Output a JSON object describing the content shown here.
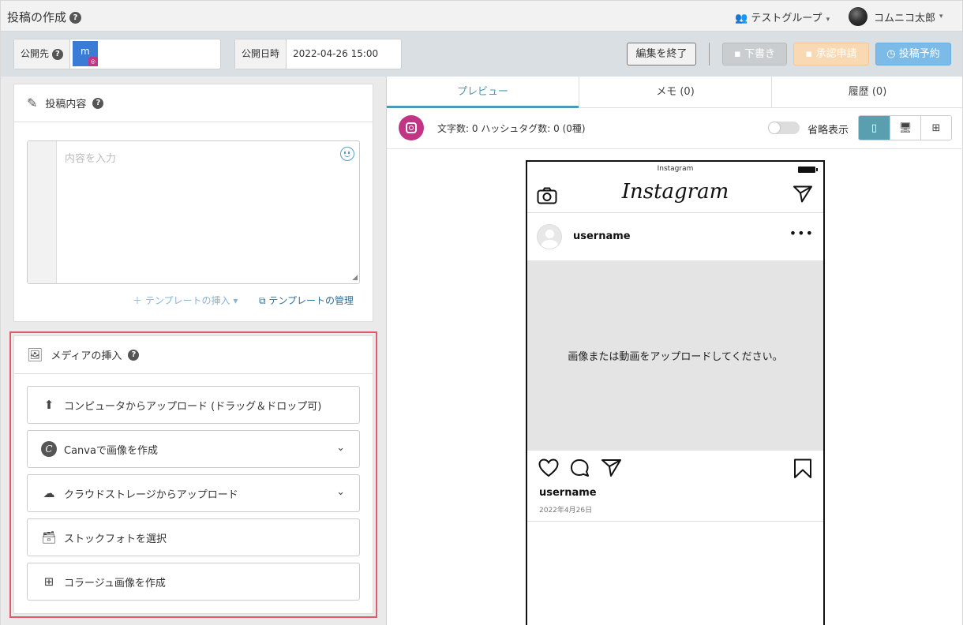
{
  "header": {
    "title": "投稿の作成",
    "group": "テストグループ",
    "user": "コムニコ太郎"
  },
  "toolbar": {
    "publish_to_label": "公開先",
    "account_badge": "m",
    "publish_date_label": "公開日時",
    "publish_date_value": "2022-04-26 15:00",
    "end_edit": "編集を終了",
    "draft": "下書き",
    "approval": "承認申請",
    "schedule": "投稿予約"
  },
  "content_panel": {
    "title": "投稿内容",
    "placeholder": "内容を入力",
    "template_insert": "テンプレートの挿入",
    "template_manage": "テンプレートの管理"
  },
  "media_panel": {
    "title": "メディアの挿入",
    "buttons": [
      {
        "label": "コンピュータからアップロード (ドラッグ＆ドロップ可)",
        "icon": "upload-icon"
      },
      {
        "label": "Canvaで画像を作成",
        "icon": "canva-icon"
      },
      {
        "label": "クラウドストレージからアップロード",
        "icon": "cloud-upload-icon"
      },
      {
        "label": "ストックフォトを選択",
        "icon": "stock-photo-icon"
      },
      {
        "label": "コラージュ画像を作成",
        "icon": "collage-icon"
      }
    ]
  },
  "preview": {
    "tabs": [
      "プレビュー",
      "メモ (0)",
      "履歴 (0)"
    ],
    "counts": "文字数: 0 ハッシュタグ数: 0 (0種)",
    "abbreviate": "省略表示",
    "phone_status": "Instagram",
    "logo": "Instagram",
    "username": "username",
    "media_message": "画像または動画をアップロードしてください。",
    "footer_username": "username",
    "date": "2022年4月26日"
  },
  "colors": {
    "accent": "#4a9ab5",
    "instagram": "#c13584",
    "highlight": "#e05a6e"
  }
}
